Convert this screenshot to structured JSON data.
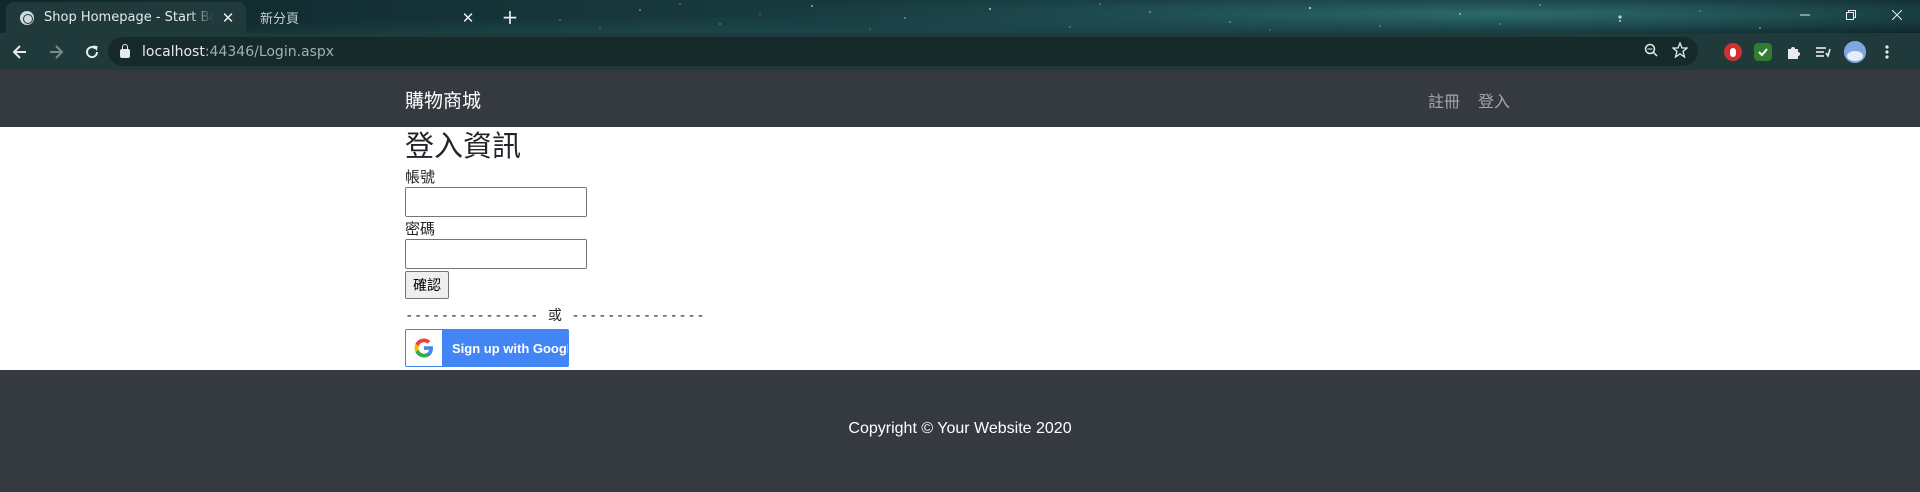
{
  "browser": {
    "tabs": [
      {
        "title": "Shop Homepage - Start Bootst",
        "active": true
      },
      {
        "title": "新分頁",
        "active": false
      }
    ],
    "new_tab_symbol": "+",
    "close_symbol": "✕",
    "url_host": "localhost",
    "url_rest": ":44346/Login.aspx",
    "nav_icons": [
      "back-arrow-icon",
      "forward-arrow-icon",
      "reload-icon"
    ],
    "omnibox_icons": [
      "zoom-icon",
      "bookmark-star-icon"
    ],
    "extension_icons": [
      "adblock-icon",
      "shield-extension-icon",
      "puzzle-extensions-icon",
      "reading-list-icon",
      "profile-avatar-icon",
      "kebab-menu-icon"
    ],
    "window_controls": [
      "minimize-icon",
      "restore-icon",
      "close-window-icon"
    ]
  },
  "navbar": {
    "brand": "購物商城",
    "links": [
      "註冊",
      "登入"
    ]
  },
  "login": {
    "heading": "登入資訊",
    "account_label": "帳號",
    "account_value": "",
    "password_label": "密碼",
    "password_value": "",
    "submit_label": "確認",
    "divider": "--------------- 或 ---------------",
    "google_button": "Sign up with Google",
    "google_logo": "G"
  },
  "footer": {
    "copyright": "Copyright © Your Website 2020"
  },
  "colors": {
    "navbar_bg": "#343a40",
    "footer_bg": "#343a40",
    "google_blue": "#4285f4",
    "chrome_frame": "#203a3c"
  }
}
